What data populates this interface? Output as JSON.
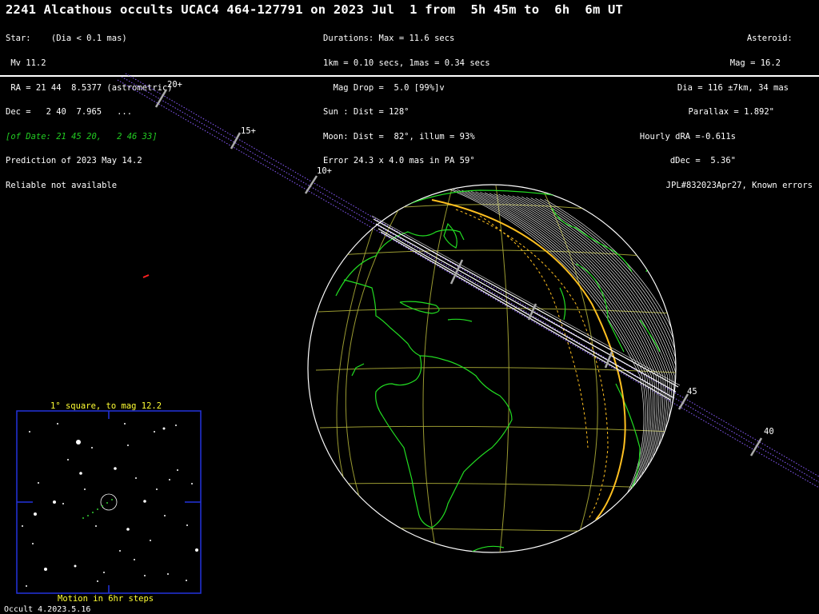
{
  "title": "2241 Alcathous occults UCAC4 464-127791 on 2023 Jul  1 from  5h 45m to  6h  6m UT",
  "star": {
    "lines": [
      "Star:    (Dia < 0.1 mas)",
      " Mv 11.2",
      " RA = 21 44  8.5377 (astrometric)",
      "Dec =   2 40  7.965   ...",
      "[of Date: 21 45 20,   2 46 33]",
      "Prediction of 2023 May 14.2",
      "Reliable not available"
    ],
    "green_line_index": 4
  },
  "event": {
    "lines": [
      "Durations: Max = 11.6 secs",
      "1km = 0.10 secs, 1mas = 0.34 secs",
      "  Mag Drop =  5.0 [99%]v",
      "Sun : Dist = 128°",
      "Moon: Dist =  82°, illum = 93%",
      "Error 24.3 x 4.0 mas in PA 59°"
    ]
  },
  "asteroid": {
    "lines": [
      "Asteroid:    ",
      "Mag = 16.2",
      "Dia = 116 ±7km, 34 mas",
      "Parallax = 1.892\"",
      "Hourly dRA =-0.611s",
      "dDec =  5.36\"",
      "JPL#832023Apr27, Known errors"
    ]
  },
  "track_labels": [
    "20+",
    "15+",
    "10+",
    "45",
    "40"
  ],
  "inset": {
    "title": "1° square, to mag 12.2",
    "caption": "Motion in 6hr steps"
  },
  "footer": "Occult 4.2023.5.16",
  "colors": {
    "background": "#000000",
    "coastline": "#22dd22",
    "grid": "#b5b53a",
    "shadow_edge": "#ffc020",
    "track": "#ffffff",
    "inset_frame": "#2233dd",
    "inset_text": "#ffff33"
  }
}
